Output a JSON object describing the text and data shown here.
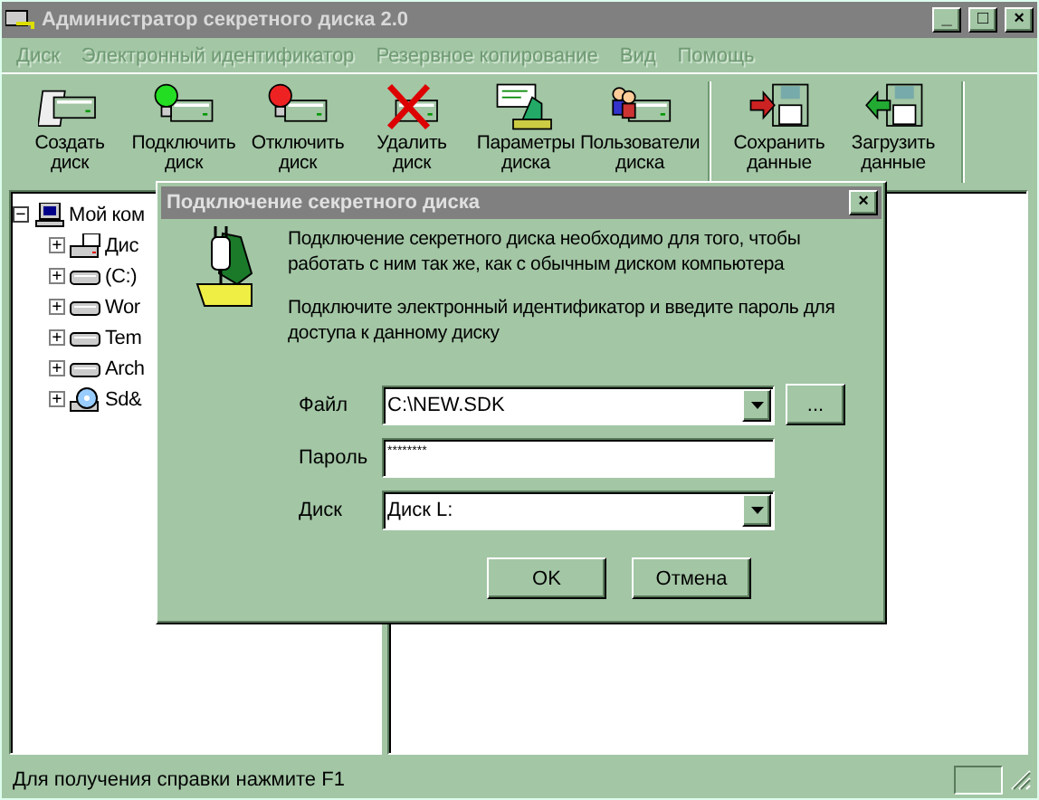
{
  "window": {
    "title": "Администратор секретного диска 2.0",
    "controls": [
      "_",
      "□",
      "×"
    ]
  },
  "menu": [
    {
      "label": "Диск",
      "disabled": true
    },
    {
      "label": "Электронный идентификатор",
      "disabled": true
    },
    {
      "label": "Резервное копирование",
      "disabled": true
    },
    {
      "label": "Вид",
      "disabled": true
    },
    {
      "label": "Помощь",
      "disabled": true
    }
  ],
  "toolbar": [
    {
      "buttons": [
        {
          "kind": "create",
          "label": "Создать диск"
        },
        {
          "kind": "connect",
          "label": "Подключить диск"
        },
        {
          "kind": "disconnect",
          "label": "Отключить диск"
        },
        {
          "kind": "delete",
          "label": "Удалить диск"
        },
        {
          "kind": "params",
          "label": "Параметры диска"
        },
        {
          "kind": "users",
          "label": "Пользователи диска"
        }
      ]
    },
    {
      "buttons": [
        {
          "kind": "save",
          "label": "Сохранить данные"
        },
        {
          "kind": "load",
          "label": "Загрузить данные"
        }
      ]
    }
  ],
  "tree": [
    {
      "label": "Мой ком",
      "toggle": "−",
      "kind": "computer",
      "expanded": true,
      "children": [
        {
          "label": "Дис",
          "toggle": "+",
          "kind": "netdrive",
          "expanded": false
        },
        {
          "label": "(C:)",
          "toggle": "+",
          "kind": "drive",
          "expanded": false
        },
        {
          "label": "Wor",
          "toggle": "+",
          "kind": "drive",
          "expanded": false
        },
        {
          "label": "Tem",
          "toggle": "+",
          "kind": "drive",
          "expanded": false
        },
        {
          "label": "Arch",
          "toggle": "+",
          "kind": "drive",
          "expanded": false
        },
        {
          "label": "Sd&",
          "toggle": "+",
          "kind": "cd",
          "expanded": false
        }
      ]
    }
  ],
  "dialog": {
    "title": "Подключение секретного диска",
    "close": "×",
    "paragraphs": [
      "Подключение секретного диска необходимо для того, чтобы работать с ним так же, как с обычным диском компьютера",
      "Подключите электронный идентификатор и введите пароль для доступа к данному диску"
    ],
    "fields": [
      {
        "label": "Файл",
        "kind": "combo",
        "value": "C:\\NEW.SDK",
        "browse": "..."
      },
      {
        "label": "Пароль",
        "kind": "password",
        "value": "********"
      },
      {
        "label": "Диск",
        "kind": "combo",
        "value": "Диск L:"
      }
    ],
    "buttons": [
      "OK",
      "Отмена"
    ]
  },
  "status_bar": {
    "text": "Для получения справки нажмите F1"
  }
}
